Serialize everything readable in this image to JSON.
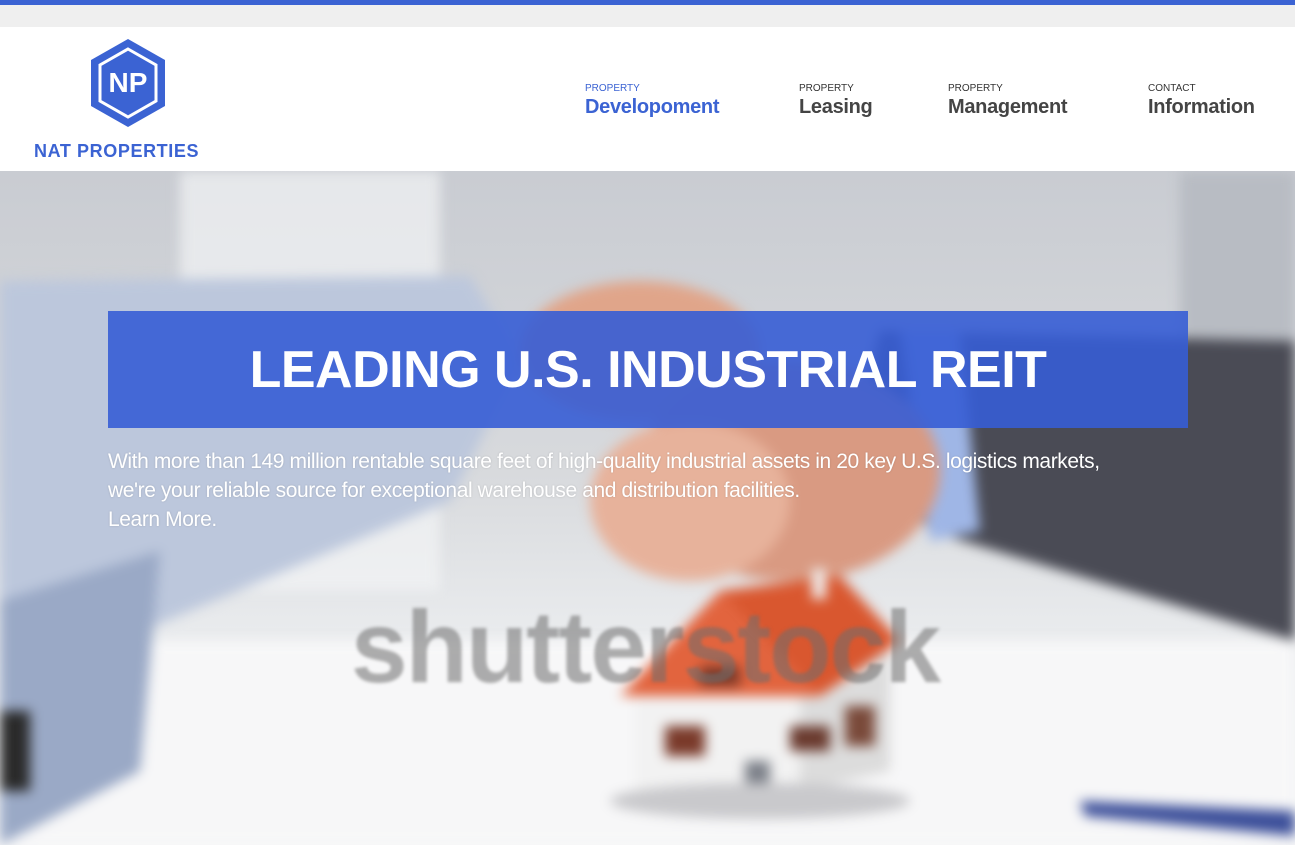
{
  "brand": {
    "monogram": "NP",
    "name": "NAT PROPERTIES",
    "color": "#3b63d3"
  },
  "nav": [
    {
      "kicker": "PROPERTY",
      "label": "Developoment",
      "active": true
    },
    {
      "kicker": "PROPERTY",
      "label": "Leasing",
      "active": false
    },
    {
      "kicker": "PROPERTY",
      "label": "Management",
      "active": false
    },
    {
      "kicker": "CONTACT",
      "label": "Information",
      "active": false
    }
  ],
  "hero": {
    "title": "LEADING U.S. INDUSTRIAL REIT",
    "body": "With more than 149 million rentable square feet of high-quality industrial assets in 20 key U.S. logistics markets, we're your reliable source for exceptional warehouse and distribution facilities.",
    "link": "Learn More.",
    "watermark": "shutterstock"
  }
}
